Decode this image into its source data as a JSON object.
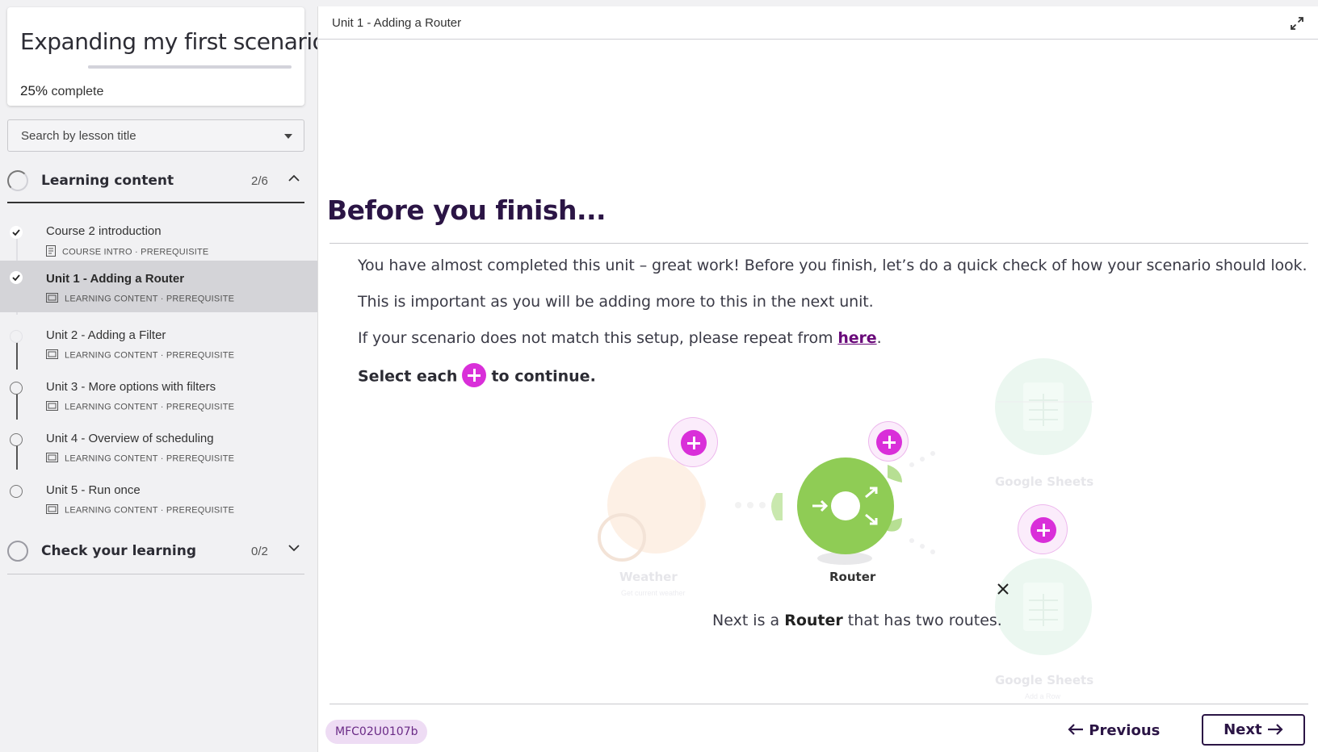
{
  "sidebar": {
    "course_title": "Expanding my first scenario",
    "progress_percent": "25%",
    "progress_suffix": " complete",
    "progress_fraction": 0.25,
    "search_placeholder": "Search by lesson title",
    "sections": [
      {
        "title": "Learning content",
        "count": "2/6",
        "expanded": true,
        "lessons": [
          {
            "name": "Course 2 introduction",
            "type": "COURSE INTRO",
            "tag": "PREREQUISITE",
            "status": "done",
            "icon": "document-icon"
          },
          {
            "name": "Unit 1 - Adding a Router",
            "type": "LEARNING CONTENT",
            "tag": "PREREQUISITE",
            "status": "done",
            "active": true,
            "icon": "slides-icon"
          },
          {
            "name": "Unit 2 - Adding a Filter",
            "type": "LEARNING CONTENT",
            "tag": "PREREQUISITE",
            "status": "faint",
            "icon": "slides-icon"
          },
          {
            "name": "Unit 3 - More options with filters",
            "type": "LEARNING CONTENT",
            "tag": "PREREQUISITE",
            "status": "todo",
            "icon": "slides-icon"
          },
          {
            "name": "Unit 4 - Overview of scheduling",
            "type": "LEARNING CONTENT",
            "tag": "PREREQUISITE",
            "status": "todo",
            "icon": "slides-icon"
          },
          {
            "name": "Unit 5 - Run once",
            "type": "LEARNING CONTENT",
            "tag": "PREREQUISITE",
            "status": "todo",
            "icon": "slides-icon"
          }
        ]
      },
      {
        "title": "Check your learning",
        "count": "0/2",
        "expanded": false
      }
    ],
    "meta_separator": "·"
  },
  "main": {
    "breadcrumb": "Unit 1 - Adding a Router",
    "heading": "Before you finish...",
    "paragraphs": [
      "You have almost completed this unit – great work! Before you finish, let’s do a quick check of how your scenario should look.",
      "This is important as you will be adding more to this in the next unit."
    ],
    "repeat_prefix": "If your scenario does not match this setup, please repeat from ",
    "repeat_link": "here",
    "repeat_suffix": ".",
    "select_prefix": "Select each",
    "select_suffix": "to continue.",
    "diagram": {
      "modules": [
        {
          "label": "Weather",
          "sublabel": "Get current weather",
          "color": "#fbe6d4"
        },
        {
          "label": "Router",
          "color": "#8fcc55"
        },
        {
          "label": "Google Sheets",
          "sublabel": "",
          "color": "#e3f3ea"
        },
        {
          "label": "Google Sheets",
          "sublabel": "Add a Row",
          "color": "#e3f3ea"
        }
      ],
      "caption_prefix": "Next is a ",
      "caption_bold": "Router",
      "caption_suffix": " that has two routes."
    },
    "footer": {
      "code": "MFC02U0107b",
      "previous_label": "Previous",
      "next_label": "Next"
    }
  },
  "colors": {
    "accent": "#d92fd9",
    "heading": "#2b1545",
    "link": "#6a0a7a",
    "router": "#8fcc55"
  }
}
